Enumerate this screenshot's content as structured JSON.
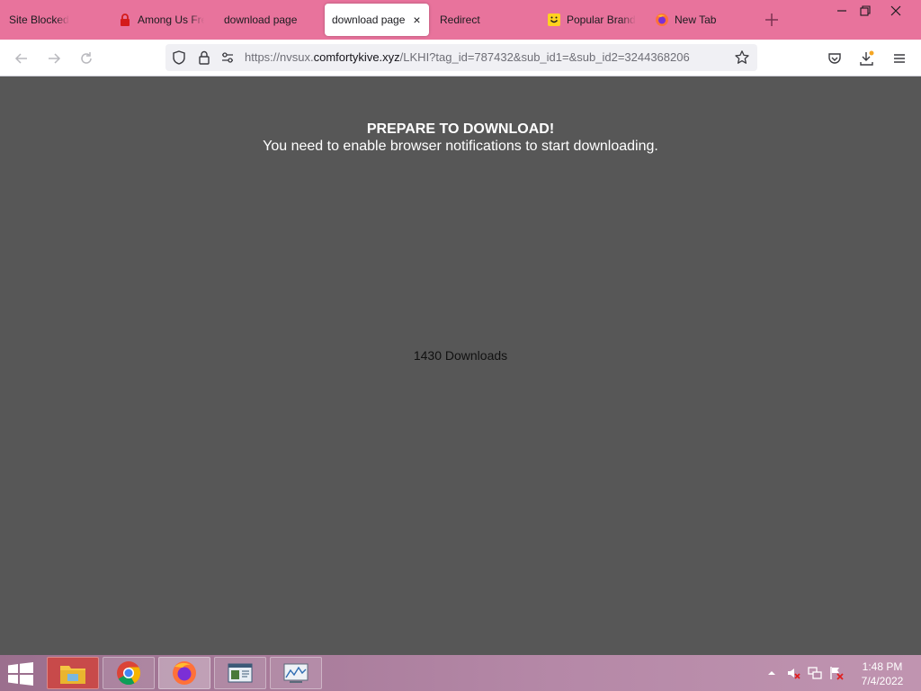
{
  "tabs": [
    {
      "title": "Site Blocked",
      "icon": "none"
    },
    {
      "title": "Among Us Fre",
      "icon": "red-lock-icon"
    },
    {
      "title": "download page",
      "icon": "none"
    },
    {
      "title": "download page",
      "icon": "none",
      "active": true
    },
    {
      "title": "Redirect",
      "icon": "none"
    },
    {
      "title": "Popular Brand",
      "icon": "yellow-smiley-icon"
    },
    {
      "title": "New Tab",
      "icon": "firefox-icon"
    }
  ],
  "tab_close": "×",
  "url": {
    "prefix": "https://nvsux.",
    "domain": "comfortykive.xyz",
    "path": "/LKHI?tag_id=787432&sub_id1=&sub_id2=3244368206"
  },
  "page": {
    "heading": "PREPARE TO DOWNLOAD!",
    "subheading": "You need to enable browser notifications to start downloading.",
    "downloads": "1430 Downloads"
  },
  "clock": {
    "time": "1:48 PM",
    "date": "7/4/2022"
  },
  "colors": {
    "tabbar": "#e8739c",
    "content_bg": "#575757",
    "taskbar": "#b588a7"
  }
}
